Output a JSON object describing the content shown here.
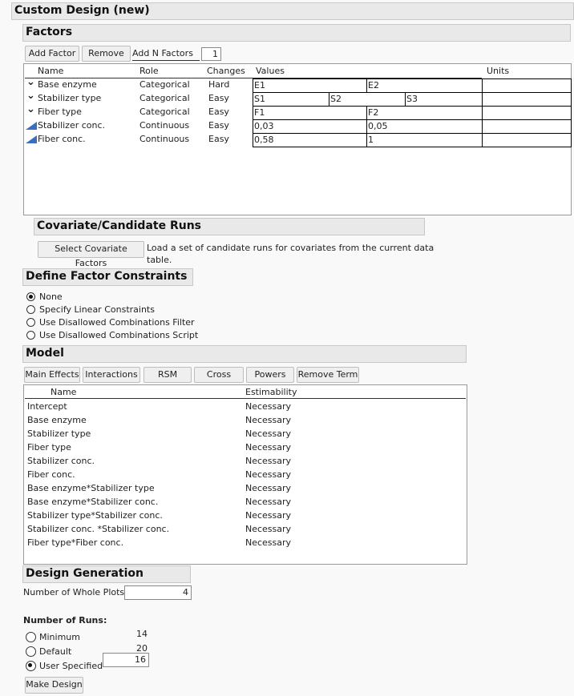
{
  "title": "Custom Design (new)",
  "factors": {
    "header": "Factors",
    "add_factor": "Add Factor",
    "remove": "Remove",
    "add_n_label": "Add N Factors",
    "add_n_value": "1",
    "columns": [
      "Name",
      "Role",
      "Changes",
      "Values",
      "Units"
    ],
    "rows": [
      {
        "icon": "chevron-down-icon",
        "name": "Base enzyme",
        "role": "Categorical",
        "changes": "Hard",
        "values": [
          "E1",
          "E2"
        ]
      },
      {
        "icon": "chevron-down-icon",
        "name": "Stabilizer type",
        "role": "Categorical",
        "changes": "Easy",
        "values": [
          "S1",
          "S2",
          "S3"
        ]
      },
      {
        "icon": "chevron-down-icon",
        "name": "Fiber type",
        "role": "Categorical",
        "changes": "Easy",
        "values": [
          "F1",
          "F2"
        ]
      },
      {
        "icon": "continuous-icon",
        "name": "Stabilizer conc.",
        "role": "Continuous",
        "changes": "Easy",
        "values": [
          "0,03",
          "0,05"
        ]
      },
      {
        "icon": "continuous-icon",
        "name": "Fiber conc.",
        "role": "Continuous",
        "changes": "Easy",
        "values": [
          "0,58",
          "1"
        ]
      }
    ]
  },
  "covariate": {
    "header": "Covariate/Candidate Runs",
    "button": "Select Covariate Factors",
    "text1": "Load a set of candidate runs for covariates from the current data",
    "text2": "table."
  },
  "constraints": {
    "header": "Define Factor Constraints",
    "options": [
      "None",
      "Specify Linear Constraints",
      "Use Disallowed Combinations Filter",
      "Use Disallowed Combinations Script"
    ],
    "selected": 0
  },
  "model": {
    "header": "Model",
    "buttons": [
      "Main Effects",
      "Interactions",
      "RSM",
      "Cross",
      "Powers",
      "Remove Term"
    ],
    "columns": [
      "Name",
      "Estimability"
    ],
    "terms": [
      [
        "Intercept",
        "Necessary"
      ],
      [
        "Base enzyme",
        "Necessary"
      ],
      [
        "Stabilizer type",
        "Necessary"
      ],
      [
        "Fiber type",
        "Necessary"
      ],
      [
        "Stabilizer conc.",
        "Necessary"
      ],
      [
        "Fiber conc.",
        "Necessary"
      ],
      [
        "Base enzyme*Stabilizer type",
        "Necessary"
      ],
      [
        "Base enzyme*Stabilizer conc.",
        "Necessary"
      ],
      [
        "Stabilizer type*Stabilizer conc.",
        "Necessary"
      ],
      [
        "Stabilizer conc. *Stabilizer conc.",
        "Necessary"
      ],
      [
        "Fiber type*Fiber conc.",
        "Necessary"
      ]
    ]
  },
  "generation": {
    "header": "Design Generation",
    "whole_plots_label": "Number of Whole Plots",
    "whole_plots": "4",
    "runs_label": "Number of Runs:",
    "runs": [
      {
        "label": "Minimum",
        "value": "14"
      },
      {
        "label": "Default",
        "value": "20"
      },
      {
        "label": "User Specified",
        "value": "16"
      }
    ],
    "selected": 2,
    "make_design": "Make Design"
  }
}
